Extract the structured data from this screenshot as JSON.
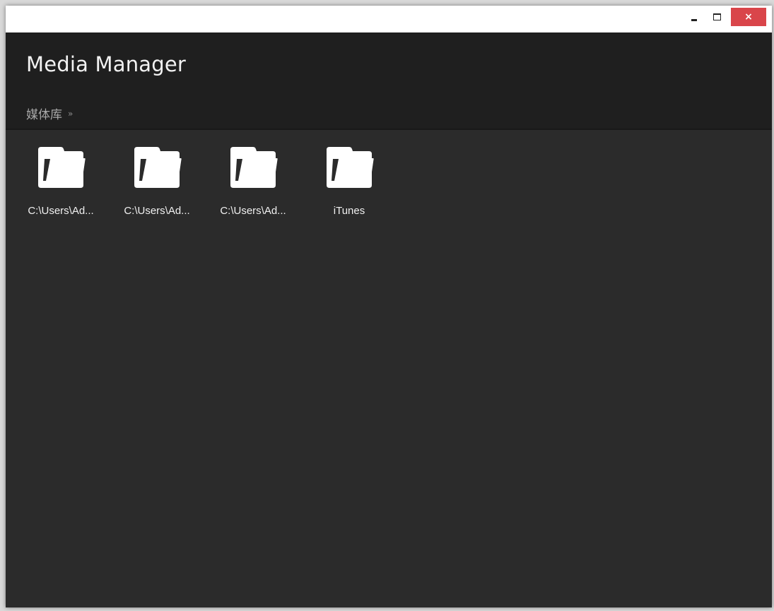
{
  "window": {
    "controls": {
      "minimize_icon": "minimize-icon",
      "maximize_icon": "maximize-icon",
      "close_icon": "close-icon",
      "close_glyph": "×",
      "close_color": "#d9454a"
    }
  },
  "header": {
    "title": "Media Manager",
    "breadcrumb": {
      "items": [
        "媒体库"
      ],
      "separator": "»"
    }
  },
  "library": {
    "folders": [
      {
        "label": "C:\\Users\\Ad...",
        "icon": "folder-icon"
      },
      {
        "label": "C:\\Users\\Ad...",
        "icon": "folder-icon"
      },
      {
        "label": "C:\\Users\\Ad...",
        "icon": "folder-icon"
      },
      {
        "label": "iTunes",
        "icon": "folder-icon"
      }
    ]
  },
  "colors": {
    "header_bg": "#1f1f1f",
    "content_bg": "#2b2b2b",
    "title_text": "#f2f2f2",
    "breadcrumb_text": "#a8a8a8",
    "folder_icon": "#ffffff"
  }
}
